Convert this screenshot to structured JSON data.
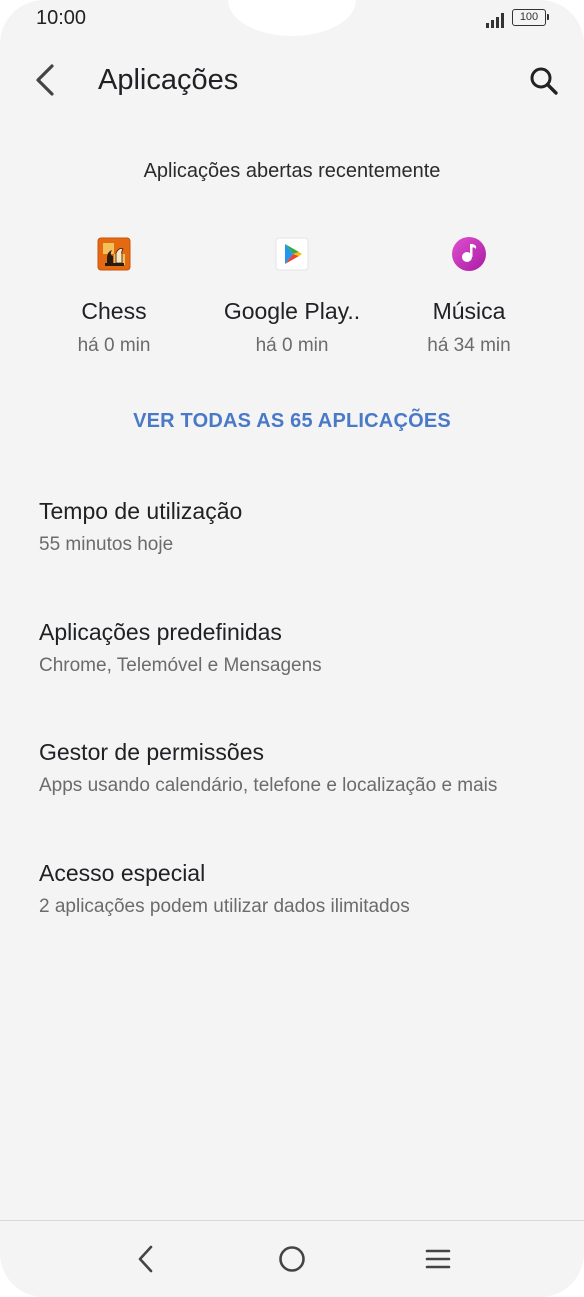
{
  "status_bar": {
    "time": "10:00",
    "battery": "100",
    "icons": [
      "signal-icon",
      "battery-icon"
    ]
  },
  "app_bar": {
    "title": "Aplicações",
    "back_icon": "back-arrow-icon",
    "search_icon": "search-icon"
  },
  "recent": {
    "heading": "Aplicações abertas recentemente",
    "apps": [
      {
        "name": "Chess",
        "time": "há 0 min",
        "icon": "chess-app-icon"
      },
      {
        "name": "Google Play..",
        "time": "há 0 min",
        "icon": "google-play-icon"
      },
      {
        "name": "Música",
        "time": "há 34 min",
        "icon": "music-app-icon"
      }
    ]
  },
  "see_all_label": "VER TODAS AS 65 APLICAÇÕES",
  "settings": [
    {
      "title": "Tempo de utilização",
      "subtitle": "55 minutos hoje"
    },
    {
      "title": "Aplicações predefinidas",
      "subtitle": "Chrome, Telemóvel e Mensagens"
    },
    {
      "title": "Gestor de permissões",
      "subtitle": "Apps usando calendário, telefone e localização e mais"
    },
    {
      "title": "Acesso especial",
      "subtitle": "2 aplicações podem utilizar dados ilimitados"
    }
  ],
  "nav_bar": {
    "icons": [
      "nav-back-icon",
      "nav-home-icon",
      "nav-menu-icon"
    ]
  },
  "colors": {
    "background": "#f4f4f4",
    "accent": "#4a79c8",
    "music": "#c02bb5"
  }
}
